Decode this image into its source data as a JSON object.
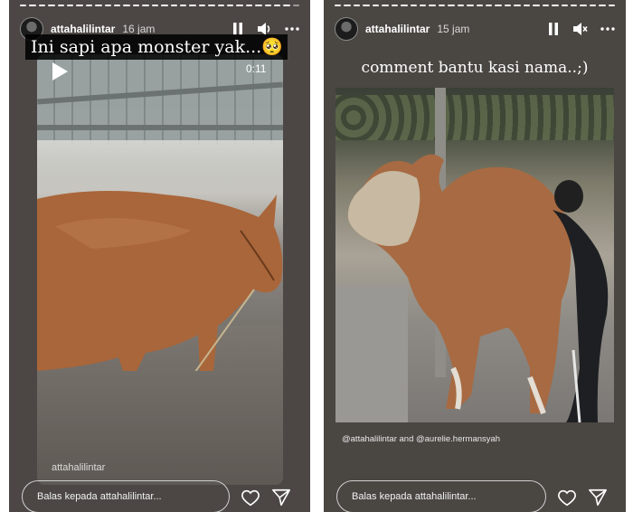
{
  "stories": [
    {
      "username": "attahalilintar",
      "time": "16 jam",
      "caption": "Ini sapi apa monster yak...🥺",
      "duration": "0:11",
      "watermark": "attahalilintar",
      "reply_placeholder": "Balas kepada attahalilintar...",
      "progress_segments": 30,
      "progress_done": 29,
      "icons": [
        "pause-icon",
        "volume-icon",
        "more-icon",
        "play-icon",
        "heart-icon",
        "send-icon"
      ]
    },
    {
      "username": "attahalilintar",
      "time": "15 jam",
      "caption": "comment bantu kasi nama..;)",
      "mention": "@attahalilintar and @aurelie.hermansyah",
      "reply_placeholder": "Balas kepada attahalilintar...",
      "progress_segments": 30,
      "progress_done": 30,
      "icons": [
        "pause-icon",
        "mute-icon",
        "more-icon",
        "heart-icon",
        "send-icon"
      ]
    }
  ]
}
